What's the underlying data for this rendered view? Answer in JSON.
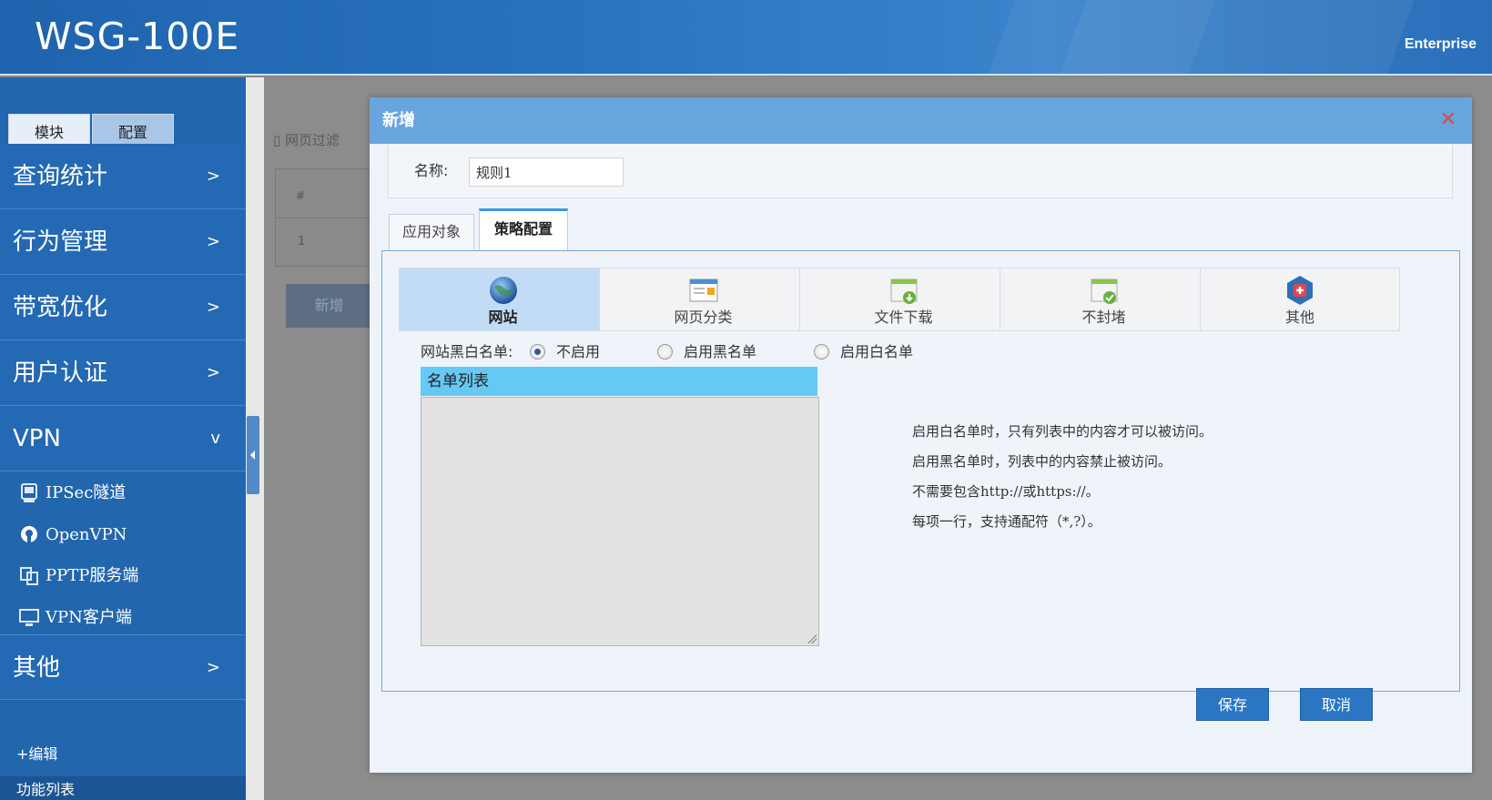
{
  "header": {
    "brand": "WSG-100E",
    "edition": "Enterprise"
  },
  "sidebar": {
    "tabs": [
      "模块",
      "配置"
    ],
    "items": [
      {
        "label": "查询统计",
        "chevron": ">"
      },
      {
        "label": "行为管理",
        "chevron": ">"
      },
      {
        "label": "带宽优化",
        "chevron": ">"
      },
      {
        "label": "用户认证",
        "chevron": ">"
      },
      {
        "label": "VPN",
        "chevron": "v"
      },
      {
        "label": "其他",
        "chevron": ">"
      }
    ],
    "vpn_subitems": [
      {
        "label": "IPSec隧道",
        "icon": "ipsec-tunnel-icon"
      },
      {
        "label": "OpenVPN",
        "icon": "openvpn-icon"
      },
      {
        "label": "PPTP服务端",
        "icon": "pptp-server-icon"
      },
      {
        "label": "VPN客户端",
        "icon": "vpn-client-icon"
      }
    ],
    "edit_link": "+编辑",
    "func_list": "功能列表"
  },
  "background": {
    "breadcrumb": "网页过滤",
    "table_header": "#",
    "table_row_num": "1",
    "add_button": "新增"
  },
  "modal": {
    "title": "新增",
    "close": "✕",
    "name_label": "名称:",
    "name_value": "规则1",
    "tabs": [
      "应用对象",
      "策略配置"
    ],
    "active_tab": "策略配置",
    "subtabs": [
      {
        "label": "网站",
        "icon": "globe-icon"
      },
      {
        "label": "网页分类",
        "icon": "web-category-icon"
      },
      {
        "label": "文件下载",
        "icon": "file-download-icon"
      },
      {
        "label": "不封堵",
        "icon": "no-block-icon"
      },
      {
        "label": "其他",
        "icon": "other-icon"
      }
    ],
    "active_subtab": "网站",
    "bw_label": "网站黑白名单:",
    "bw_options": [
      "不启用",
      "启用黑名单",
      "启用白名单"
    ],
    "bw_selected": "不启用",
    "list_header": "名单列表",
    "help_lines": [
      "启用白名单时，只有列表中的内容才可以被访问。",
      "启用黑名单时，列表中的内容禁止被访问。",
      "不需要包含http://或https://。",
      "每项一行，支持通配符（*,?）。"
    ],
    "save_button": "保存",
    "cancel_button": "取消"
  },
  "colors": {
    "header_blue": "#2a73bf",
    "sidebar_blue": "#2266ad",
    "modal_title": "#68a5df",
    "list_header": "#66c8f4",
    "button_blue": "#2a76c3",
    "close_red": "#e04848"
  }
}
